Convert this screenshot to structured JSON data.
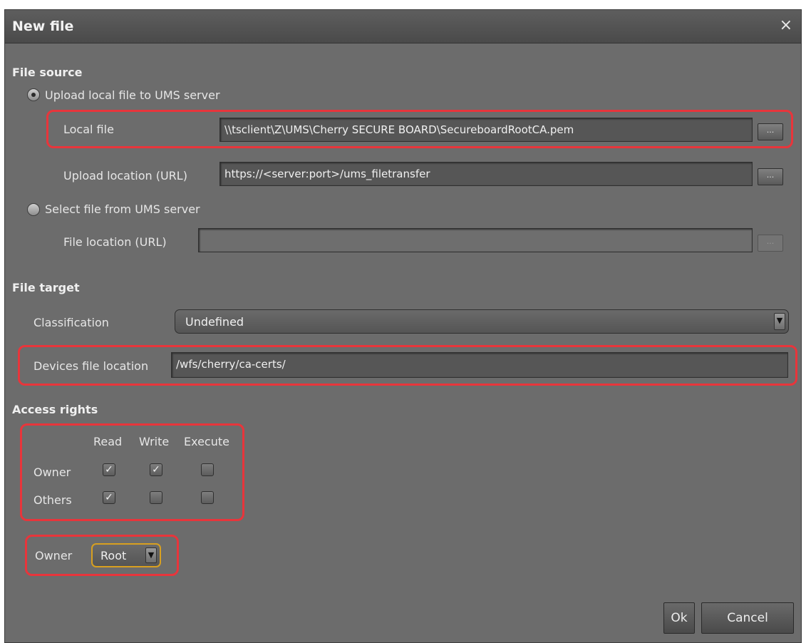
{
  "dialog": {
    "title": "New file",
    "close_glyph": "×",
    "close_icon": "close-icon"
  },
  "file_source": {
    "heading": "File source",
    "upload_option_label": "Upload local file to UMS server",
    "upload_selected": true,
    "local_file_label": "Local file",
    "local_file_value": "\\\\tsclient\\Z\\UMS\\Cherry SECURE BOARD\\SecureboardRootCA.pem",
    "upload_location_label": "Upload location (URL)",
    "upload_location_value": "https://<server:port>/ums_filetransfer",
    "select_option_label": "Select file from UMS server",
    "select_selected": false,
    "file_location_label": "File location (URL)",
    "file_location_value": "",
    "browse_label": "..."
  },
  "file_target": {
    "heading": "File target",
    "classification_label": "Classification",
    "classification_value": "Undefined",
    "devices_location_label": "Devices file location",
    "devices_location_value": "/wfs/cherry/ca-certs/"
  },
  "access_rights": {
    "heading": "Access rights",
    "columns": [
      "Read",
      "Write",
      "Execute"
    ],
    "rows": [
      {
        "label": "Owner",
        "checks": [
          true,
          true,
          false
        ]
      },
      {
        "label": "Others",
        "checks": [
          true,
          false,
          false
        ]
      }
    ],
    "check_glyph": "✓",
    "owner_label": "Owner",
    "owner_value": "Root"
  },
  "buttons": {
    "ok": "Ok",
    "cancel": "Cancel"
  },
  "dropdown_glyph": "▼",
  "colors": {
    "highlight": "#e8353b",
    "panel": "#6c6c6c",
    "titlebar": "#4a4a4a"
  }
}
